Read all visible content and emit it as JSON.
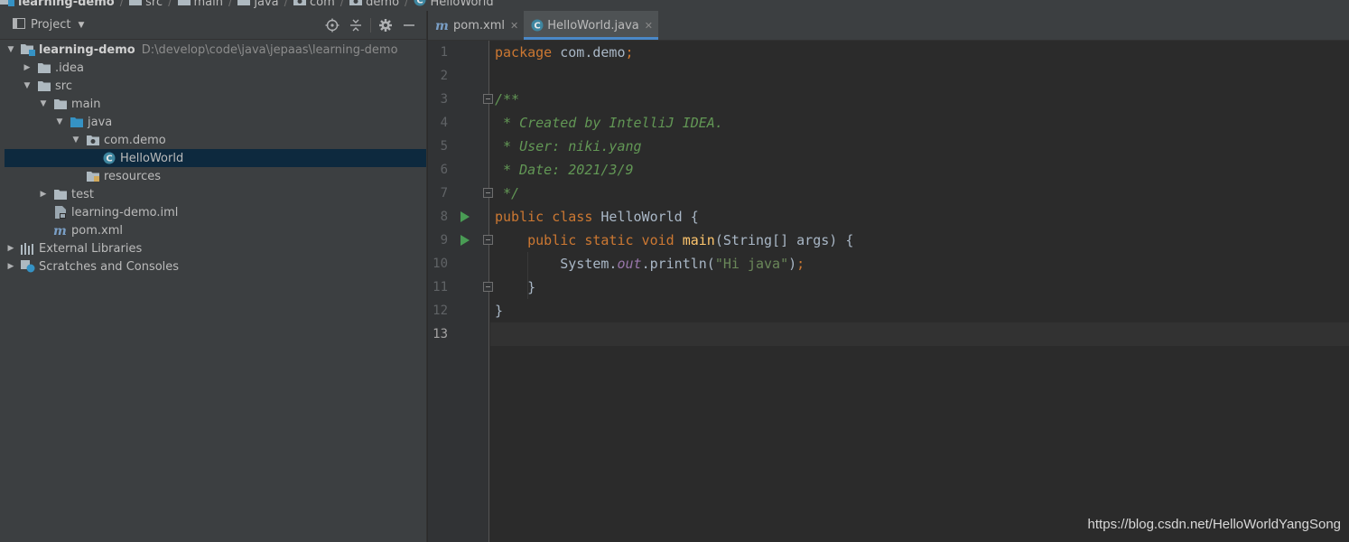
{
  "breadcrumb": [
    "learning-demo",
    "src",
    "main",
    "java",
    "com",
    "demo",
    "HelloWorld"
  ],
  "project_panel": {
    "title": "Project",
    "tools": [
      "locate-icon",
      "collapse-all-icon",
      "gear-icon",
      "hide-icon"
    ]
  },
  "tree": [
    {
      "label": "learning-demo",
      "path": "D:\\develop\\code\\java\\jepaas\\learning-demo",
      "level": 0,
      "expanded": true,
      "icon": "module-folder-icon"
    },
    {
      "label": ".idea",
      "level": 1,
      "expanded": false,
      "icon": "folder-icon"
    },
    {
      "label": "src",
      "level": 1,
      "expanded": true,
      "icon": "folder-icon"
    },
    {
      "label": "main",
      "level": 2,
      "expanded": true,
      "icon": "folder-icon"
    },
    {
      "label": "java",
      "level": 3,
      "expanded": true,
      "icon": "source-folder-icon"
    },
    {
      "label": "com.demo",
      "level": 4,
      "expanded": true,
      "icon": "package-icon"
    },
    {
      "label": "HelloWorld",
      "level": 5,
      "expanded": null,
      "icon": "java-class-icon",
      "selected": true
    },
    {
      "label": "resources",
      "level": 4,
      "expanded": null,
      "icon": "resources-folder-icon"
    },
    {
      "label": "test",
      "level": 2,
      "expanded": false,
      "icon": "folder-icon"
    },
    {
      "label": "learning-demo.iml",
      "level": 2,
      "expanded": null,
      "icon": "iml-file-icon"
    },
    {
      "label": "pom.xml",
      "level": 2,
      "expanded": null,
      "icon": "maven-icon"
    },
    {
      "label": "External Libraries",
      "level": 0,
      "expanded": false,
      "icon": "libraries-icon"
    },
    {
      "label": "Scratches and Consoles",
      "level": 0,
      "expanded": false,
      "icon": "scratches-icon"
    }
  ],
  "tabs": [
    {
      "label": "pom.xml",
      "icon": "maven-icon",
      "active": false
    },
    {
      "label": "HelloWorld.java",
      "icon": "java-class-icon",
      "active": true
    }
  ],
  "editor": {
    "current_line": 13,
    "line_numbers": [
      "1",
      "2",
      "3",
      "4",
      "5",
      "6",
      "7",
      "8",
      "9",
      "10",
      "11",
      "12",
      "13"
    ],
    "run_markers": [
      8,
      9
    ],
    "fold_markers": [
      3,
      7,
      9,
      11
    ],
    "lines": [
      [
        {
          "t": "package",
          "c": "kw"
        },
        {
          "t": " com.demo",
          "c": "plain"
        },
        {
          "t": ";",
          "c": "kw"
        }
      ],
      [],
      [
        {
          "t": "/**",
          "c": "doc"
        }
      ],
      [
        {
          "t": " * Created by IntelliJ IDEA.",
          "c": "doc"
        }
      ],
      [
        {
          "t": " * User: niki.yang",
          "c": "doc"
        }
      ],
      [
        {
          "t": " * Date: 2021/3/9",
          "c": "doc"
        }
      ],
      [
        {
          "t": " */",
          "c": "doc"
        }
      ],
      [
        {
          "t": "public class ",
          "c": "kw"
        },
        {
          "t": "HelloWorld {",
          "c": "plain"
        }
      ],
      [
        {
          "t": "    public static void ",
          "c": "kw"
        },
        {
          "t": "main",
          "c": "fn"
        },
        {
          "t": "(String[] args) {",
          "c": "plain"
        }
      ],
      [
        {
          "t": "        System.",
          "c": "plain"
        },
        {
          "t": "out",
          "c": "fld"
        },
        {
          "t": ".println(",
          "c": "plain"
        },
        {
          "t": "\"Hi java\"",
          "c": "str"
        },
        {
          "t": ")",
          "c": "plain"
        },
        {
          "t": ";",
          "c": "kw"
        }
      ],
      [
        {
          "t": "    }",
          "c": "plain"
        }
      ],
      [
        {
          "t": "}",
          "c": "plain"
        }
      ],
      []
    ]
  },
  "watermark": "https://blog.csdn.net/HelloWorldYangSong"
}
